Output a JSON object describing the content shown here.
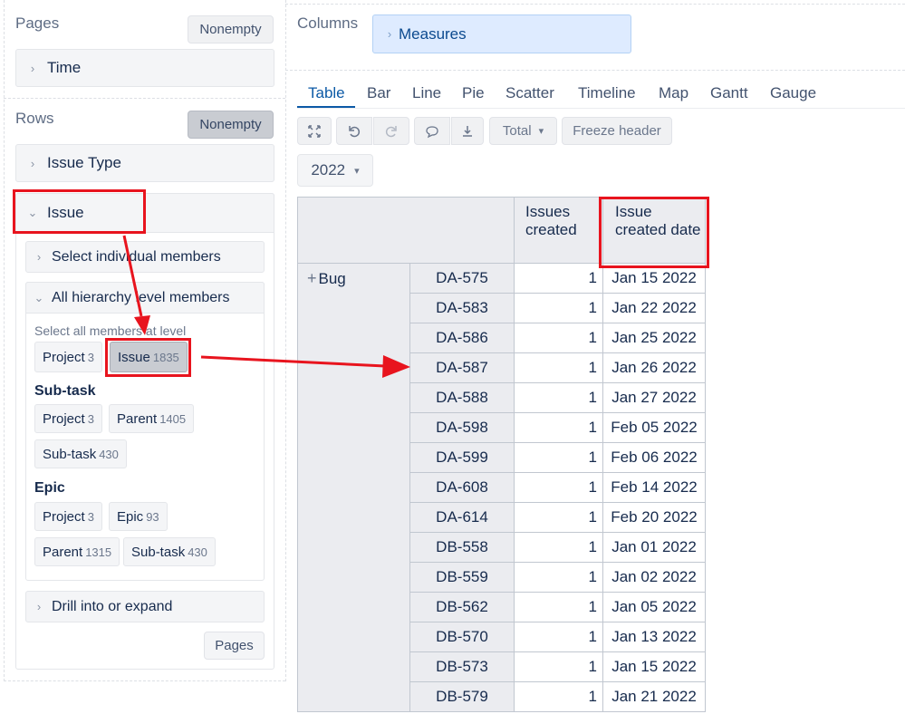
{
  "pages": {
    "title": "Pages",
    "nonempty_label": "Nonempty",
    "dimensions": [
      {
        "label": "Time"
      }
    ]
  },
  "columns": {
    "title": "Columns",
    "dimension": {
      "label": "Measures"
    }
  },
  "rows": {
    "title": "Rows",
    "nonempty_label": "Nonempty",
    "dimensions": [
      {
        "label": "Issue Type"
      },
      {
        "label": "Issue"
      }
    ],
    "select_individual_label": "Select individual members",
    "all_hierarchy_label": "All hierarchy level members",
    "select_all_hint": "Select all members at level",
    "levels_default": [
      {
        "name": "Project",
        "count": "3"
      },
      {
        "name": "Issue",
        "count": "1835"
      }
    ],
    "groups": [
      {
        "title": "Sub-task",
        "levels": [
          {
            "name": "Project",
            "count": "3"
          },
          {
            "name": "Parent",
            "count": "1405"
          },
          {
            "name": "Sub-task",
            "count": "430"
          }
        ]
      },
      {
        "title": "Epic",
        "levels": [
          {
            "name": "Project",
            "count": "3"
          },
          {
            "name": "Epic",
            "count": "93"
          },
          {
            "name": "Parent",
            "count": "1315"
          },
          {
            "name": "Sub-task",
            "count": "430"
          }
        ]
      }
    ],
    "drill_label": "Drill into or expand",
    "pages_button": "Pages"
  },
  "view_tabs": [
    "Table",
    "Bar",
    "Line",
    "Pie",
    "Scatter",
    "Timeline",
    "Map",
    "Gantt",
    "Gauge"
  ],
  "active_tab": "Table",
  "toolbar": {
    "total_label": "Total",
    "freeze_label": "Freeze header",
    "year_filter": "2022"
  },
  "table": {
    "headers": {
      "issues_created": "Issues created",
      "issue_created_date": "Issue created date"
    },
    "group_label": "Bug",
    "rows": [
      {
        "key": "DA-575",
        "issues_created": "1",
        "date": "Jan 15 2022"
      },
      {
        "key": "DA-583",
        "issues_created": "1",
        "date": "Jan 22 2022"
      },
      {
        "key": "DA-586",
        "issues_created": "1",
        "date": "Jan 25 2022"
      },
      {
        "key": "DA-587",
        "issues_created": "1",
        "date": "Jan 26 2022"
      },
      {
        "key": "DA-588",
        "issues_created": "1",
        "date": "Jan 27 2022"
      },
      {
        "key": "DA-598",
        "issues_created": "1",
        "date": "Feb 05 2022"
      },
      {
        "key": "DA-599",
        "issues_created": "1",
        "date": "Feb 06 2022"
      },
      {
        "key": "DA-608",
        "issues_created": "1",
        "date": "Feb 14 2022"
      },
      {
        "key": "DA-614",
        "issues_created": "1",
        "date": "Feb 20 2022"
      },
      {
        "key": "DB-558",
        "issues_created": "1",
        "date": "Jan 01 2022"
      },
      {
        "key": "DB-559",
        "issues_created": "1",
        "date": "Jan 02 2022"
      },
      {
        "key": "DB-562",
        "issues_created": "1",
        "date": "Jan 05 2022"
      },
      {
        "key": "DB-570",
        "issues_created": "1",
        "date": "Jan 13 2022"
      },
      {
        "key": "DB-573",
        "issues_created": "1",
        "date": "Jan 15 2022"
      },
      {
        "key": "DB-579",
        "issues_created": "1",
        "date": "Jan 21 2022"
      }
    ]
  },
  "annotation_color": "#e8141e",
  "accent_color": "#0c5aa6"
}
